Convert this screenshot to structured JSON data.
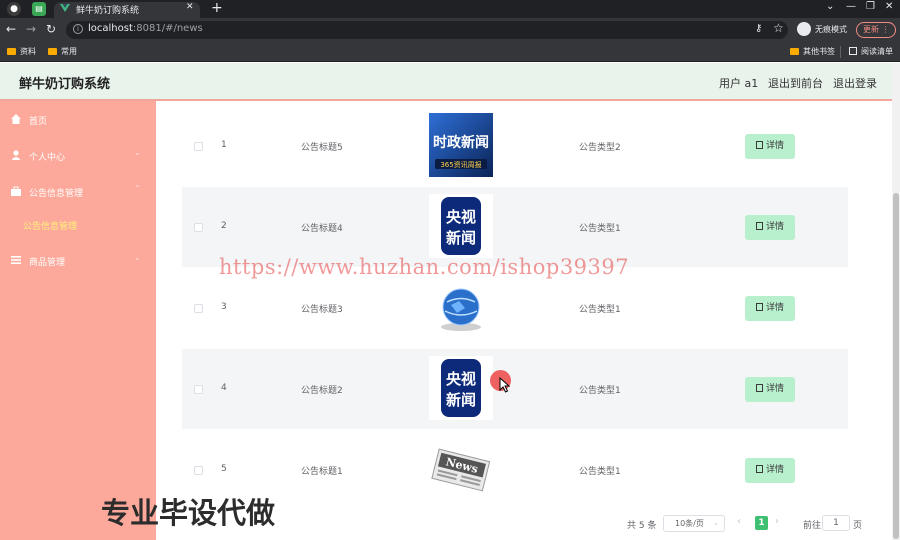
{
  "browser": {
    "tab_title": "鲜牛奶订购系统",
    "url_host": "localhost",
    "url_rest": ":8081/#/news",
    "incognito_label": "无痕模式",
    "update_label": "更新",
    "bookmarks": [
      "资料",
      "常用"
    ],
    "other_bookmarks": "其他书签",
    "reading_list": "阅读清单"
  },
  "header": {
    "title": "鲜牛奶订购系统",
    "user_label": "用户 a1",
    "front_link": "退出到前台",
    "logout_link": "退出登录"
  },
  "sidebar": {
    "items": [
      {
        "label": "首页",
        "icon": "home-icon"
      },
      {
        "label": "个人中心",
        "icon": "user-icon"
      },
      {
        "label": "公告信息管理",
        "icon": "briefcase-icon"
      },
      {
        "label": "商品管理",
        "icon": "list-icon"
      }
    ],
    "active_sub": "公告信息管理"
  },
  "table": {
    "rows": [
      {
        "index": "1",
        "title": "公告标题5",
        "type": "公告类型2",
        "thumb": "news-thumb-shizheng",
        "action": "详情"
      },
      {
        "index": "2",
        "title": "公告标题4",
        "type": "公告类型1",
        "thumb": "news-thumb-cctv",
        "action": "详情"
      },
      {
        "index": "3",
        "title": "公告标题3",
        "type": "公告类型1",
        "thumb": "news-thumb-globe",
        "action": "详情"
      },
      {
        "index": "4",
        "title": "公告标题2",
        "type": "公告类型1",
        "thumb": "news-thumb-cctv",
        "action": "详情"
      },
      {
        "index": "5",
        "title": "公告标题1",
        "type": "公告类型1",
        "thumb": "news-thumb-paper",
        "action": "详情"
      }
    ]
  },
  "pagination": {
    "total": "共 5 条",
    "page_size": "10条/页",
    "current": "1",
    "goto_label": "前往",
    "goto_value": "1",
    "unit": "页"
  },
  "thumb_text": {
    "shizheng_main": "时政新闻",
    "shizheng_sub": "365资讯周报",
    "cctv_top": "央视",
    "cctv_bottom": "新闻",
    "paper": "News"
  },
  "overlay": {
    "watermark": "https://www.huzhan.com/ishop39397",
    "caption": "专业毕设代做"
  },
  "colors": {
    "sidebar_bg": "#fca99b",
    "header_bg": "#e8f3ec",
    "accent_green": "#3fbf71",
    "button_green": "#b8efcd",
    "sub_active": "#fff27a"
  }
}
